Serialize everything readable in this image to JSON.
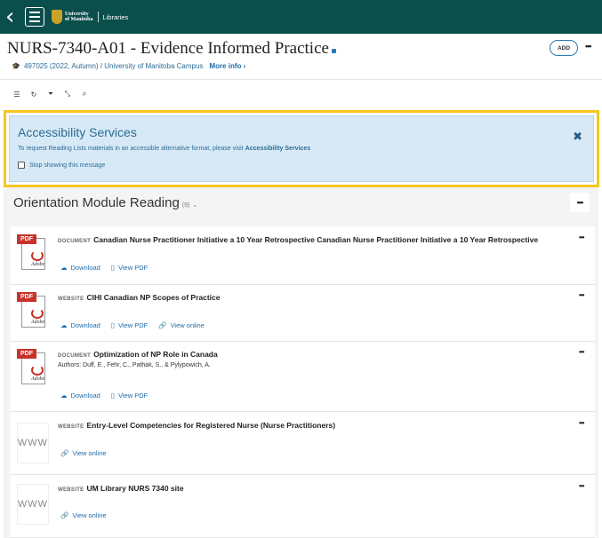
{
  "topbar": {
    "back_glyph": "‹",
    "logo_line1": "University",
    "logo_line2": "of Manitoba",
    "libraries": "Libraries"
  },
  "header": {
    "title": "NURS-7340-A01 - Evidence Informed Practice",
    "meta": "497025 (2022, Autumn) / University of Manitoba Campus",
    "more_info": "More info ›",
    "add": "ADD",
    "more": "•••"
  },
  "toolbar": {
    "icons": [
      "list-icon",
      "refresh-icon",
      "filter-icon",
      "collapse-icon",
      "search-icon"
    ],
    "glyphs": [
      "☰",
      "↻",
      "⏷",
      "⤡",
      "⌕"
    ]
  },
  "alert": {
    "title": "Accessibility Services",
    "text": "To request Reading Lists materials in an accessible alternative format, please visit",
    "link": "Accessibility Services",
    "stop": "Stop showing this message",
    "close": "✖"
  },
  "section": {
    "title": "Orientation Module Reading",
    "count": "(9)",
    "chevron": "⌄",
    "more": "•••"
  },
  "items": [
    {
      "type": "DOCUMENT",
      "title": "Canadian Nurse Practitioner Initiative a 10 Year Retrospective Canadian Nurse Practitioner Initiative a 10 Year Retrospective",
      "links": [
        "Download",
        "View PDF"
      ],
      "more": "•••"
    },
    {
      "type": "WEBSITE",
      "title": "CIHI Canadian NP Scopes of Practice",
      "links": [
        "Download",
        "View PDF",
        "View online"
      ],
      "more": "•••"
    },
    {
      "type": "DOCUMENT",
      "title": "Optimization of NP Role in Canada",
      "authors": "Authors: Duff, E., Fehr, C., Pathak, S., & Pylypowich, A.",
      "links": [
        "Download",
        "View PDF"
      ],
      "more": "•••"
    },
    {
      "type": "WEBSITE",
      "title": "Entry-Level Competencies for Registered Nurse (Nurse Practitioners)",
      "links": [
        "View online"
      ],
      "thumb": "WWW",
      "more": "•••"
    },
    {
      "type": "WEBSITE",
      "title": "UM Library NURS 7340 site",
      "links": [
        "View online"
      ],
      "thumb": "WWW",
      "more": "•••"
    }
  ],
  "pdf_thumb": {
    "label": "PDF",
    "brand": "Adobe"
  },
  "colors": {
    "topbar": "#0a4f4c",
    "alert_border": "#f6c51f",
    "alert_bg": "#d7e9f6",
    "link": "#1f6aa8"
  }
}
